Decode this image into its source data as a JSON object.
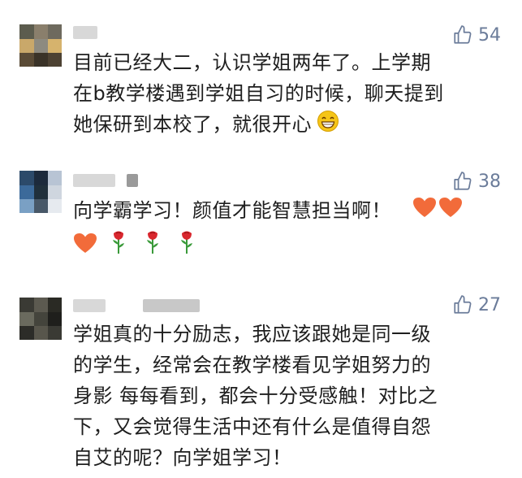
{
  "comments": [
    {
      "like_count": "54",
      "lines": [
        "目前已经大二，认识学姐两年了。上学期",
        "在b教学楼遇到学姐自习的时候，聊天提到",
        "她保研到本校了，就很开心"
      ],
      "emojis": [
        "grinning-face-icon"
      ]
    },
    {
      "like_count": "38",
      "lines": [
        "向学霸学习！颜值才能智慧担当啊！",
        ""
      ],
      "emojis": [
        "orange-heart-icon",
        "orange-heart-icon",
        "orange-heart-icon",
        "rose-icon",
        "rose-icon",
        "rose-icon"
      ]
    },
    {
      "like_count": "27",
      "lines": [
        "学姐真的十分励志，我应该跟她是同一级",
        "的学生，经常会在教学楼看见学姐努力的",
        "身影 每每看到，都会十分受感触！对比之",
        "下，又会觉得生活中还有什么是值得自怨",
        "自艾的呢？向学姐学习！"
      ],
      "emojis": []
    }
  ],
  "colors": {
    "like": "#6b7c9a",
    "heart": "#f26b3a",
    "rose_red": "#d9272e",
    "rose_stem": "#3a9a3a",
    "emoji_yellow": "#f5c518"
  }
}
